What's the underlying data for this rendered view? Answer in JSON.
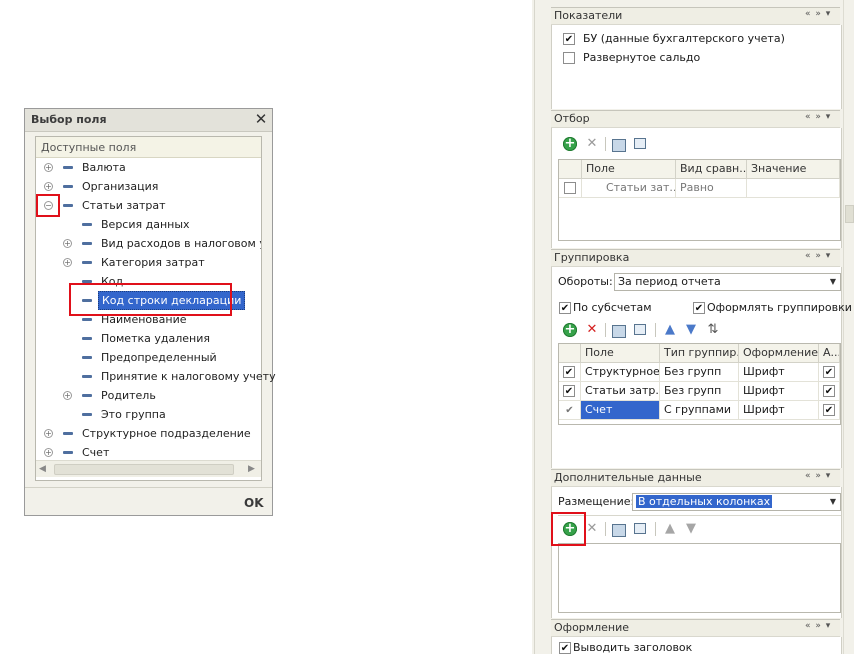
{
  "dialog": {
    "title": "Выбор поля",
    "close_glyph": "✕",
    "tree_header": "Доступные поля",
    "ok_label": "OK",
    "items": [
      {
        "label": "Валюта",
        "expand": "⊕"
      },
      {
        "label": "Организация",
        "expand": "⊕"
      },
      {
        "label": "Статьи затрат",
        "expand": "⊖"
      },
      {
        "label": "Версия данных"
      },
      {
        "label": "Вид расходов в налоговом учете",
        "expand": "⊕"
      },
      {
        "label": "Категория затрат",
        "expand": "⊕"
      },
      {
        "label": "Код"
      },
      {
        "label": "Код строки декларации"
      },
      {
        "label": "Наименование"
      },
      {
        "label": "Пометка удаления"
      },
      {
        "label": "Предопределенный"
      },
      {
        "label": "Принятие к налоговому учету"
      },
      {
        "label": "Родитель",
        "expand": "⊕"
      },
      {
        "label": "Это группа"
      },
      {
        "label": "Структурное подразделение",
        "expand": "⊕"
      },
      {
        "label": "Счет",
        "expand": "⊕"
      }
    ]
  },
  "panel": {
    "section_ctrl": "« » ▾",
    "pokazateli": {
      "title": "Показатели",
      "items": [
        {
          "label": "БУ (данные бухгалтерского учета)",
          "checked": true
        },
        {
          "label": "Развернутое сальдо",
          "checked": false
        }
      ]
    },
    "otbor": {
      "title": "Отбор",
      "columns": [
        "Поле",
        "Вид сравн...",
        "Значение"
      ],
      "rows": [
        {
          "field": "Статьи зат...",
          "compare": "Равно",
          "value": ""
        }
      ]
    },
    "gruppirovka": {
      "title": "Группировка",
      "oboroty_label": "Обороты:",
      "oboroty_value": "За период отчета",
      "po_subschetam": "По субсчетам",
      "oformlyat": "Оформлять группировки",
      "columns": [
        "Поле",
        "Тип группир...",
        "Оформление",
        "А..."
      ],
      "rows": [
        {
          "field": "Структурное...",
          "type": "Без групп",
          "format": "Шрифт"
        },
        {
          "field": "Статьи затр...",
          "type": "Без групп",
          "format": "Шрифт"
        },
        {
          "field": "Счет",
          "type": "С группами",
          "format": "Шрифт"
        }
      ]
    },
    "dop": {
      "title": "Дополнительные данные",
      "razmeshchenie_label": "Размещение:",
      "razmeshchenie_value": "В отдельных колонках"
    },
    "oformlenie": {
      "title": "Оформление",
      "vyvodit": "Выводить заголовок"
    }
  },
  "colors": {
    "highlight": "#e0101a",
    "selection": "#3366cc",
    "add_green": "#36a24a"
  }
}
